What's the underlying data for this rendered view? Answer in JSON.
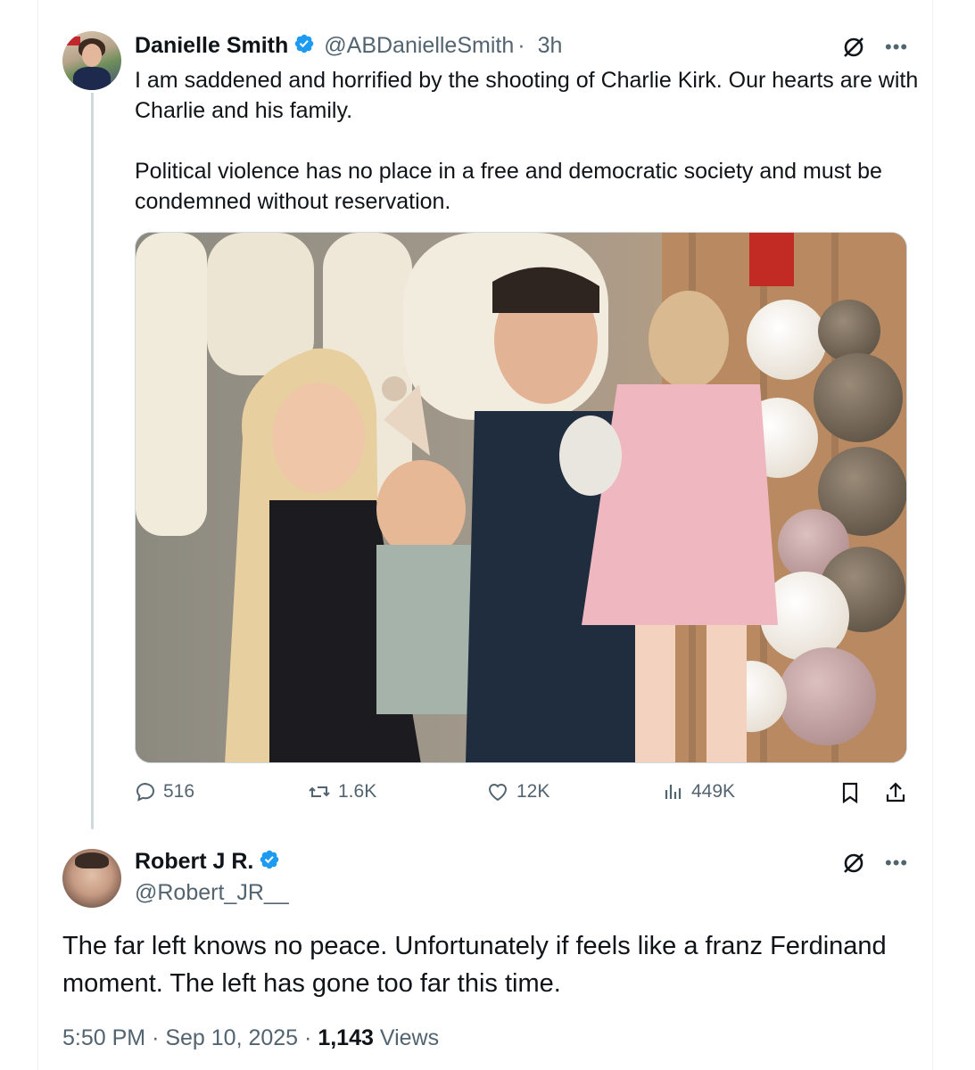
{
  "post": {
    "author_name": "Danielle Smith",
    "author_handle": "@ABDanielleSmith",
    "separator": "·",
    "time": "3h",
    "text_paragraph_1": "I am saddened and horrified by the shooting of Charlie Kirk. Our hearts are with Charlie and his family.",
    "text_paragraph_2": "Political violence has no place in a free and democratic society and must be condemned without reservation.",
    "actions": {
      "replies": "516",
      "reposts": "1.6K",
      "likes": "12K",
      "views": "449K"
    }
  },
  "reply": {
    "author_name": "Robert J R.",
    "author_handle": "@Robert_JR__",
    "text": "The far left knows no peace. Unfortunately if feels like a franz Ferdinand moment. The left has gone too far this time.",
    "timestamp_time": "5:50 PM",
    "timestamp_sep": "·",
    "timestamp_date": "Sep 10, 2025",
    "views_count": "1,143",
    "views_label": "Views"
  },
  "colors": {
    "verified_blue": "#1d9bf0",
    "secondary_text": "#536471",
    "primary_text": "#0f1419"
  }
}
